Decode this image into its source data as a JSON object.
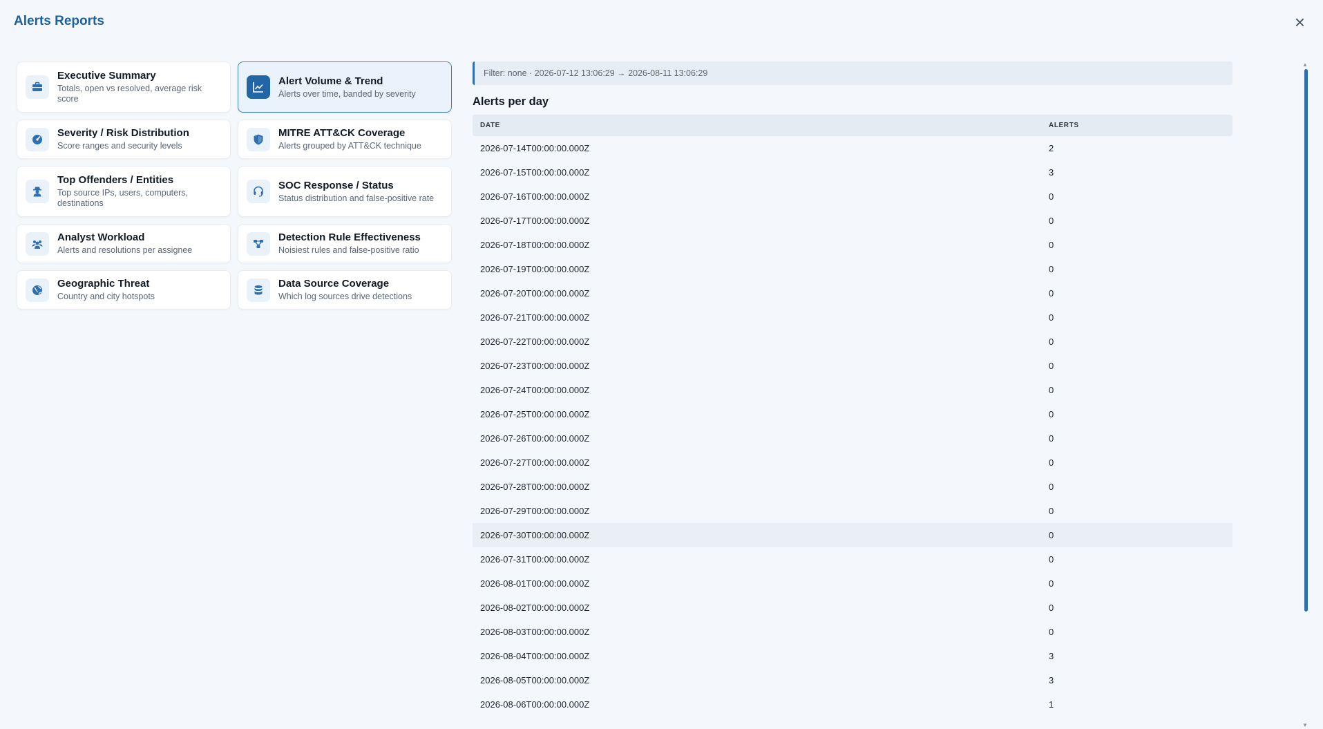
{
  "header": {
    "title": "Alerts Reports",
    "close_label": "×"
  },
  "cards": [
    {
      "title": "Executive Summary",
      "desc": "Totals, open vs resolved, average risk score",
      "icon": "briefcase-icon"
    },
    {
      "title": "Alert Volume & Trend",
      "desc": "Alerts over time, banded by severity",
      "icon": "line-chart-icon",
      "active": true
    },
    {
      "title": "Severity / Risk Distribution",
      "desc": "Score ranges and security levels",
      "icon": "gauge-icon"
    },
    {
      "title": "MITRE ATT&CK Coverage",
      "desc": "Alerts grouped by ATT&CK technique",
      "icon": "shield-icon"
    },
    {
      "title": "Top Offenders / Entities",
      "desc": "Top source IPs, users, computers, destinations",
      "icon": "user-secret-icon"
    },
    {
      "title": "SOC Response / Status",
      "desc": "Status distribution and false-positive rate",
      "icon": "headset-icon"
    },
    {
      "title": "Analyst Workload",
      "desc": "Alerts and resolutions per assignee",
      "icon": "users-icon"
    },
    {
      "title": "Detection Rule Effectiveness",
      "desc": "Noisiest rules and false-positive ratio",
      "icon": "sitemap-icon"
    },
    {
      "title": "Geographic Threat",
      "desc": "Country and city hotspots",
      "icon": "globe-icon"
    },
    {
      "title": "Data Source Coverage",
      "desc": "Which log sources drive detections",
      "icon": "database-icon"
    }
  ],
  "report": {
    "filter": "Filter: none · 2026-07-12 13:06:29 → 2026-08-11 13:06:29",
    "subtitle": "Alerts per day",
    "columns": [
      "DATE",
      "ALERTS"
    ],
    "rows": [
      [
        "2026-07-14T00:00:00.000Z",
        "2"
      ],
      [
        "2026-07-15T00:00:00.000Z",
        "3"
      ],
      [
        "2026-07-16T00:00:00.000Z",
        "0"
      ],
      [
        "2026-07-17T00:00:00.000Z",
        "0"
      ],
      [
        "2026-07-18T00:00:00.000Z",
        "0"
      ],
      [
        "2026-07-19T00:00:00.000Z",
        "0"
      ],
      [
        "2026-07-20T00:00:00.000Z",
        "0"
      ],
      [
        "2026-07-21T00:00:00.000Z",
        "0"
      ],
      [
        "2026-07-22T00:00:00.000Z",
        "0"
      ],
      [
        "2026-07-23T00:00:00.000Z",
        "0"
      ],
      [
        "2026-07-24T00:00:00.000Z",
        "0"
      ],
      [
        "2026-07-25T00:00:00.000Z",
        "0"
      ],
      [
        "2026-07-26T00:00:00.000Z",
        "0"
      ],
      [
        "2026-07-27T00:00:00.000Z",
        "0"
      ],
      [
        "2026-07-28T00:00:00.000Z",
        "0"
      ],
      [
        "2026-07-29T00:00:00.000Z",
        "0"
      ],
      [
        "2026-07-30T00:00:00.000Z",
        "0"
      ],
      [
        "2026-07-31T00:00:00.000Z",
        "0"
      ],
      [
        "2026-08-01T00:00:00.000Z",
        "0"
      ],
      [
        "2026-08-02T00:00:00.000Z",
        "0"
      ],
      [
        "2026-08-03T00:00:00.000Z",
        "0"
      ],
      [
        "2026-08-04T00:00:00.000Z",
        "3"
      ],
      [
        "2026-08-05T00:00:00.000Z",
        "3"
      ],
      [
        "2026-08-06T00:00:00.000Z",
        "1"
      ]
    ],
    "highlight_row": 16
  },
  "colors": {
    "accent": "#2266a8",
    "title": "#1e5f9e"
  }
}
